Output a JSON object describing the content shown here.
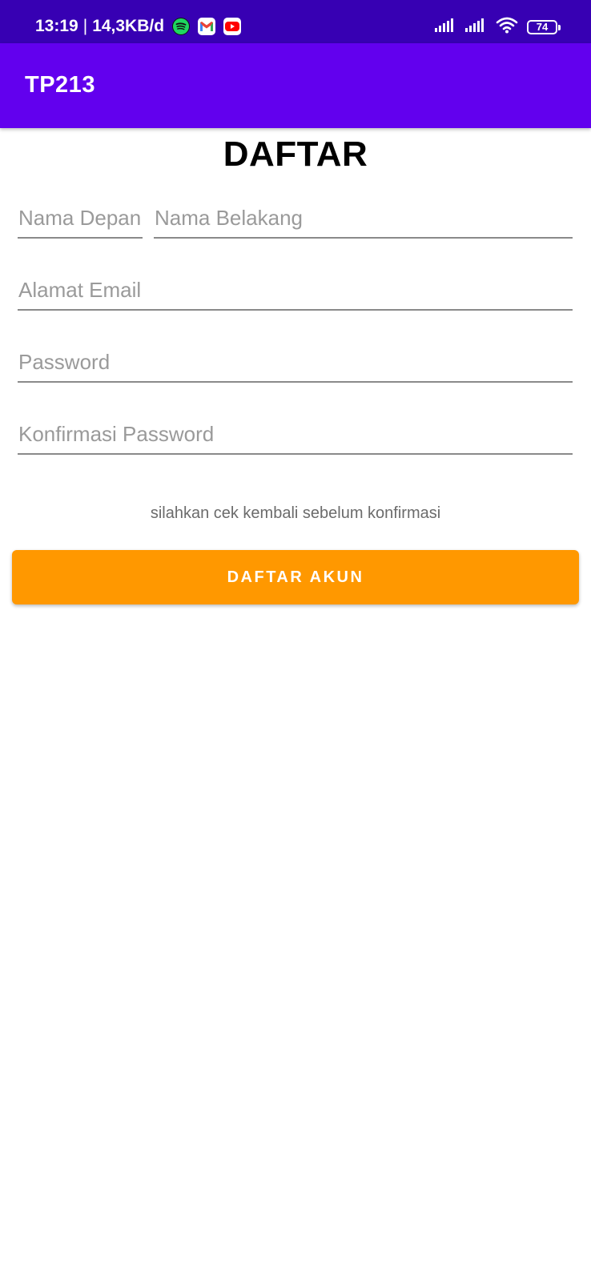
{
  "status_bar": {
    "time": "13:19",
    "separator": "|",
    "network_speed": "14,3KB/d",
    "notification_icons": [
      "spotify-icon",
      "gmail-icon",
      "youtube-icon"
    ],
    "system_icons": [
      "signal-icon",
      "signal-icon",
      "wifi-icon",
      "battery-icon"
    ],
    "battery_level": "74",
    "background_color": "#3700b3"
  },
  "app_bar": {
    "title": "TP213",
    "background_color": "#6200ee"
  },
  "form": {
    "heading": "DAFTAR",
    "first_name_placeholder": "Nama Depan",
    "last_name_placeholder": "Nama Belakang",
    "email_placeholder": "Alamat Email",
    "password_placeholder": "Password",
    "confirm_password_placeholder": "Konfirmasi Password",
    "hint": "silahkan cek kembali sebelum konfirmasi",
    "submit_label": "DAFTAR AKUN",
    "submit_color": "#ff9800"
  }
}
